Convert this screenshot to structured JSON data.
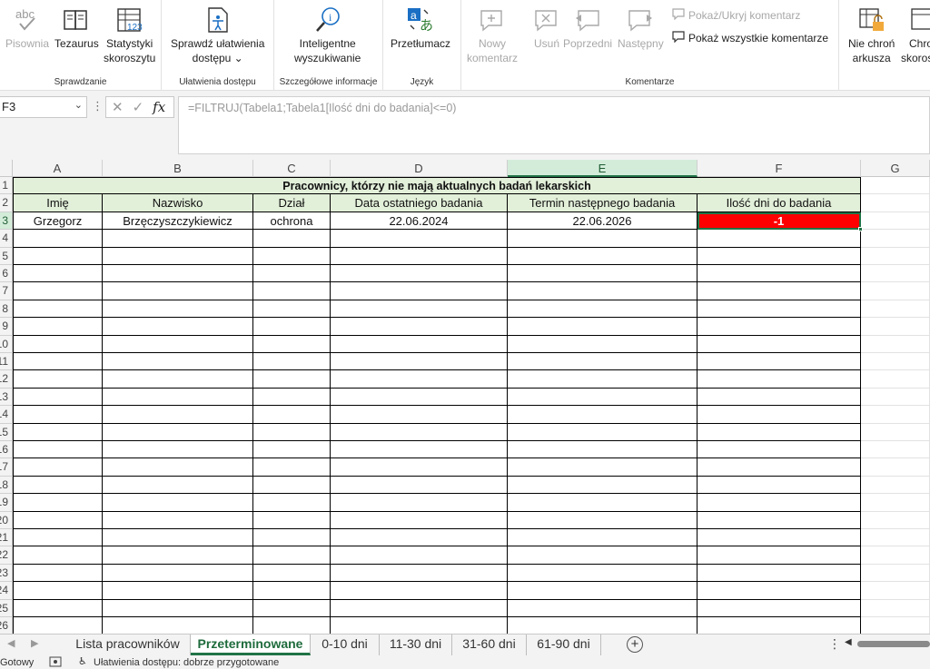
{
  "ribbon": {
    "groups": {
      "proofing": {
        "label": "Sprawdzanie",
        "buttons": [
          {
            "icon": "abc-spelling-icon",
            "label": "Pisownia",
            "disabled": true
          },
          {
            "icon": "thesaurus-book-icon",
            "label": "Tezaurus",
            "disabled": false
          },
          {
            "icon": "workbook-statistics-icon",
            "label": "Statystyki\nskoroszytu",
            "disabled": false
          }
        ]
      },
      "accessibility": {
        "label": "Ułatwienia dostępu",
        "button": {
          "icon": "accessibility-check-icon",
          "label": "Sprawdź ułatwienia\ndostępu ⌄"
        }
      },
      "insights": {
        "label": "Szczegółowe informacje",
        "button": {
          "icon": "smart-lookup-icon",
          "label": "Inteligentne\nwyszukiwanie"
        }
      },
      "language": {
        "label": "Język",
        "button": {
          "icon": "translate-icon",
          "label": "Przetłumacz"
        }
      },
      "comments": {
        "label": "Komentarze",
        "buttons": [
          {
            "icon": "new-comment-icon",
            "label": "Nowy\nkomentarz",
            "disabled": true
          },
          {
            "icon": "delete-comment-icon",
            "label": "Usuń",
            "disabled": true
          },
          {
            "icon": "previous-comment-icon",
            "label": "Poprzedni",
            "disabled": true
          },
          {
            "icon": "next-comment-icon",
            "label": "Następny",
            "disabled": true
          }
        ],
        "show_hide": "Pokaż/Ukryj komentarz",
        "show_all": "Pokaż wszystkie komentarze"
      },
      "protect": {
        "buttons": [
          {
            "icon": "unprotect-sheet-icon",
            "label": "Nie chroń\narkusza"
          },
          {
            "icon": "protect-workbook-icon",
            "label": "Chroń\nskoroszyt"
          }
        ]
      }
    }
  },
  "formula_bar": {
    "name_box": "F3",
    "formula": "=FILTRUJ(Tabela1;Tabela1[Ilość dni  do badania]<=0)"
  },
  "columns": [
    "A",
    "B",
    "C",
    "D",
    "E",
    "F",
    "G"
  ],
  "row_numbers": [
    "1",
    "2",
    "3",
    "4",
    "5",
    "6",
    "7",
    "8",
    "9",
    "10",
    "11",
    "12",
    "13",
    "14",
    "15",
    "16",
    "17",
    "18",
    "19",
    "20",
    "21",
    "22",
    "23",
    "24",
    "25",
    "26"
  ],
  "table": {
    "title": "Pracownicy, którzy nie mają aktualnych badań lekarskich",
    "headers": [
      "Imię",
      "Nazwisko",
      "Dział",
      "Data ostatniego badania",
      "Termin następnego badania",
      "Ilość dni  do badania"
    ],
    "rows": [
      [
        "Grzegorz",
        "Brzęczyszczykiewicz",
        "ochrona",
        "22.06.2024",
        "22.06.2026",
        "-1"
      ]
    ],
    "colors": {
      "title_bg": "#e2efd9",
      "alert_bg": "#ff0000",
      "alert_text": "#ffffff"
    }
  },
  "sheets": {
    "tabs": [
      "Lista pracowników",
      "Przeterminowane",
      "0-10 dni",
      "11-30 dni",
      "31-60 dni",
      "61-90 dni"
    ],
    "active": "Przeterminowane",
    "add_icon": "add-sheet-icon"
  },
  "status": {
    "ready": "Gotowy",
    "accessibility": "Ułatwienia dostępu: dobrze przygotowane"
  }
}
